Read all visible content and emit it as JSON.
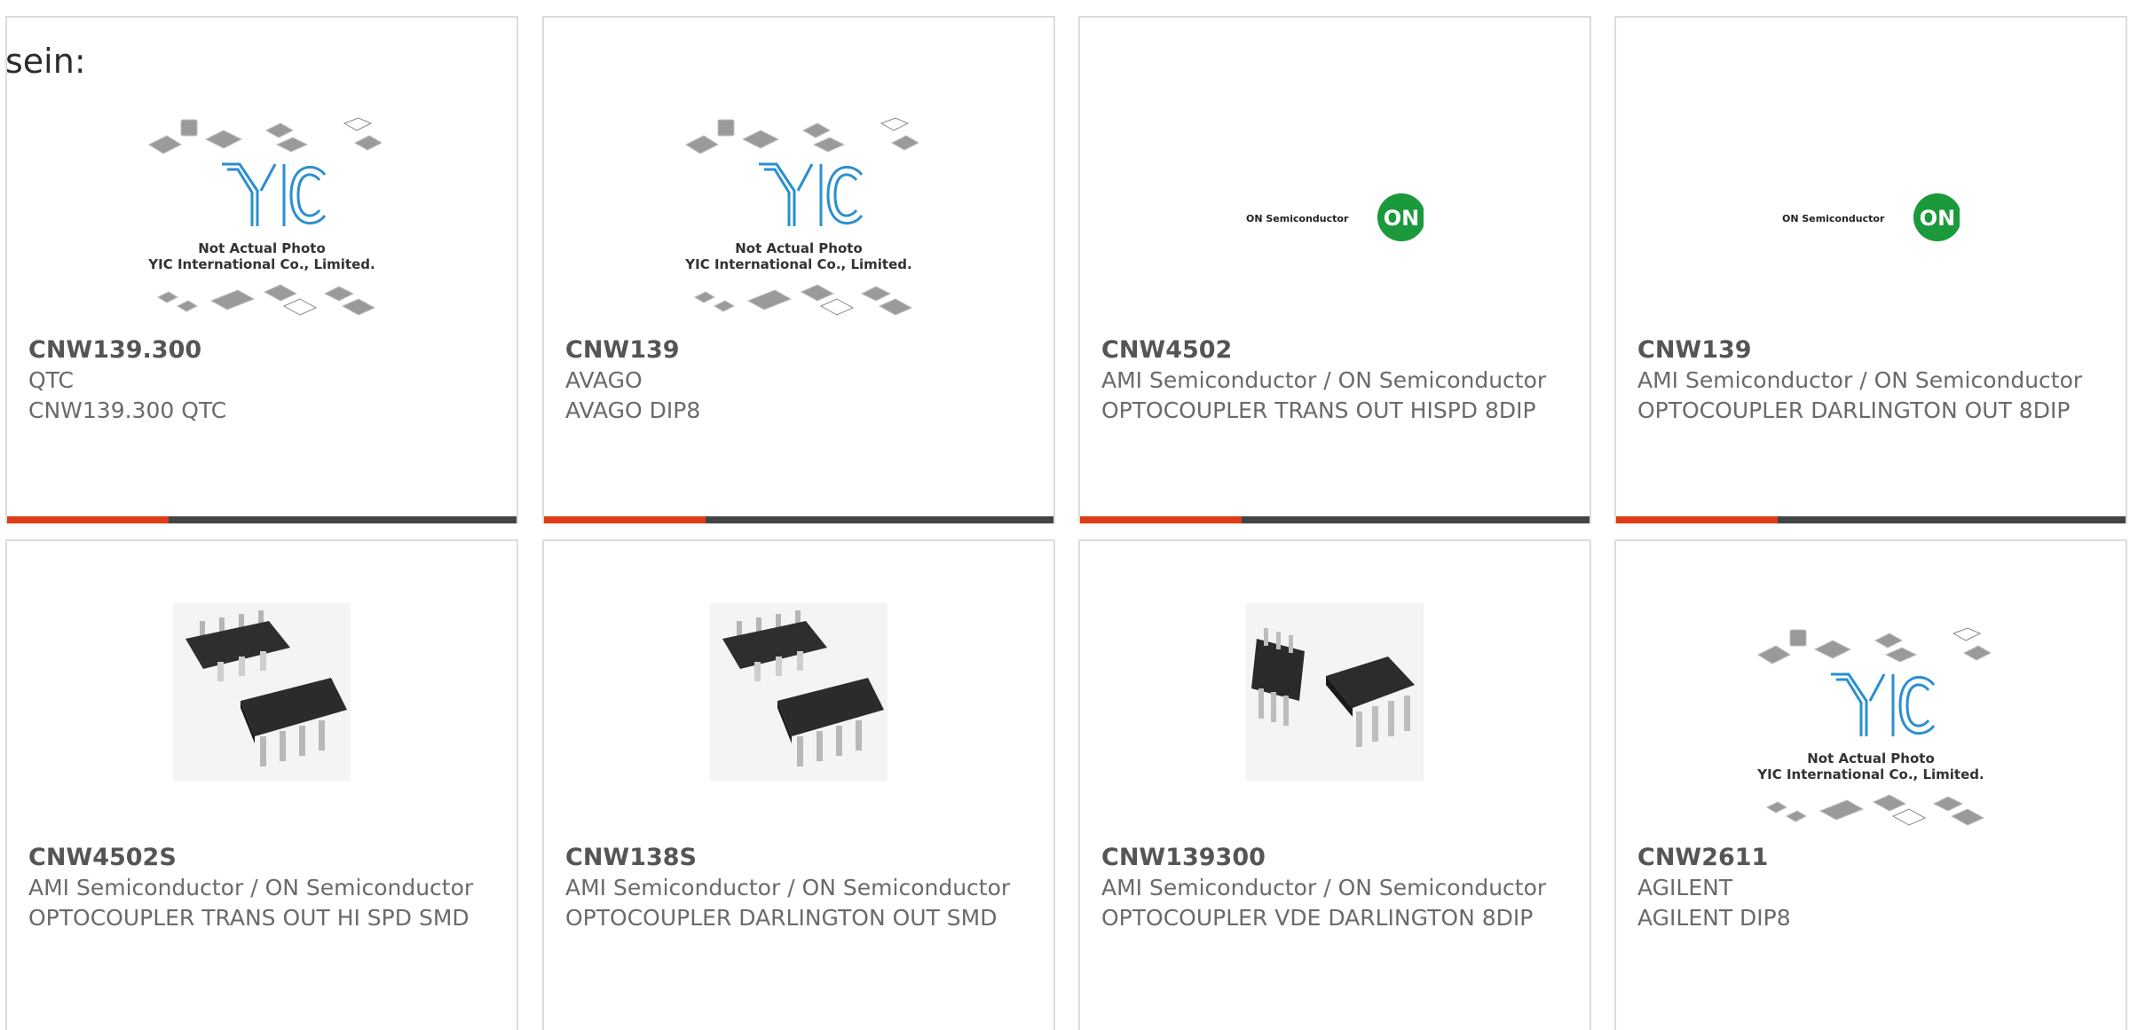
{
  "heading": "sein:",
  "colors": {
    "accent": "#e03c16",
    "bar_dark": "#444444",
    "card_border": "#dcdcdc",
    "on_logo_green": "#1a9a3a",
    "yic_blue": "#2a8fd0"
  },
  "products": [
    {
      "part_number": "CNW139.300",
      "manufacturer": "QTC",
      "description": "CNW139.300 QTC",
      "image": "yic-placeholder",
      "image_caption_1": "Not Actual Photo",
      "image_caption_2": "YIC International Co., Limited."
    },
    {
      "part_number": "CNW139",
      "manufacturer": "AVAGO",
      "description": "AVAGO DIP8",
      "image": "yic-placeholder",
      "image_caption_1": "Not Actual Photo",
      "image_caption_2": "YIC International Co., Limited."
    },
    {
      "part_number": "CNW4502",
      "manufacturer": "AMI Semiconductor / ON Semiconductor",
      "description": "OPTOCOUPLER TRANS OUT HISPD 8DIP",
      "image": "on-semiconductor-logo",
      "logo_text": "ON Semiconductor",
      "logo_badge": "ON"
    },
    {
      "part_number": "CNW139",
      "manufacturer": "AMI Semiconductor / ON Semiconductor",
      "description": "OPTOCOUPLER DARLINGTON OUT 8DIP",
      "image": "on-semiconductor-logo",
      "logo_text": "ON Semiconductor",
      "logo_badge": "ON"
    },
    {
      "part_number": "CNW4502S",
      "manufacturer": "AMI Semiconductor / ON Semiconductor",
      "description": "OPTOCOUPLER TRANS OUT HI SPD SMD",
      "image": "smd-chip-photo"
    },
    {
      "part_number": "CNW138S",
      "manufacturer": "AMI Semiconductor / ON Semiconductor",
      "description": "OPTOCOUPLER DARLINGTON OUT SMD",
      "image": "smd-chip-photo"
    },
    {
      "part_number": "CNW139300",
      "manufacturer": "AMI Semiconductor / ON Semiconductor",
      "description": "OPTOCOUPLER VDE DARLINGTON 8DIP",
      "image": "dip-chip-photo"
    },
    {
      "part_number": "CNW2611",
      "manufacturer": "AGILENT",
      "description": "AGILENT DIP8",
      "image": "yic-placeholder",
      "image_caption_1": "Not Actual Photo",
      "image_caption_2": "YIC International Co., Limited."
    }
  ]
}
